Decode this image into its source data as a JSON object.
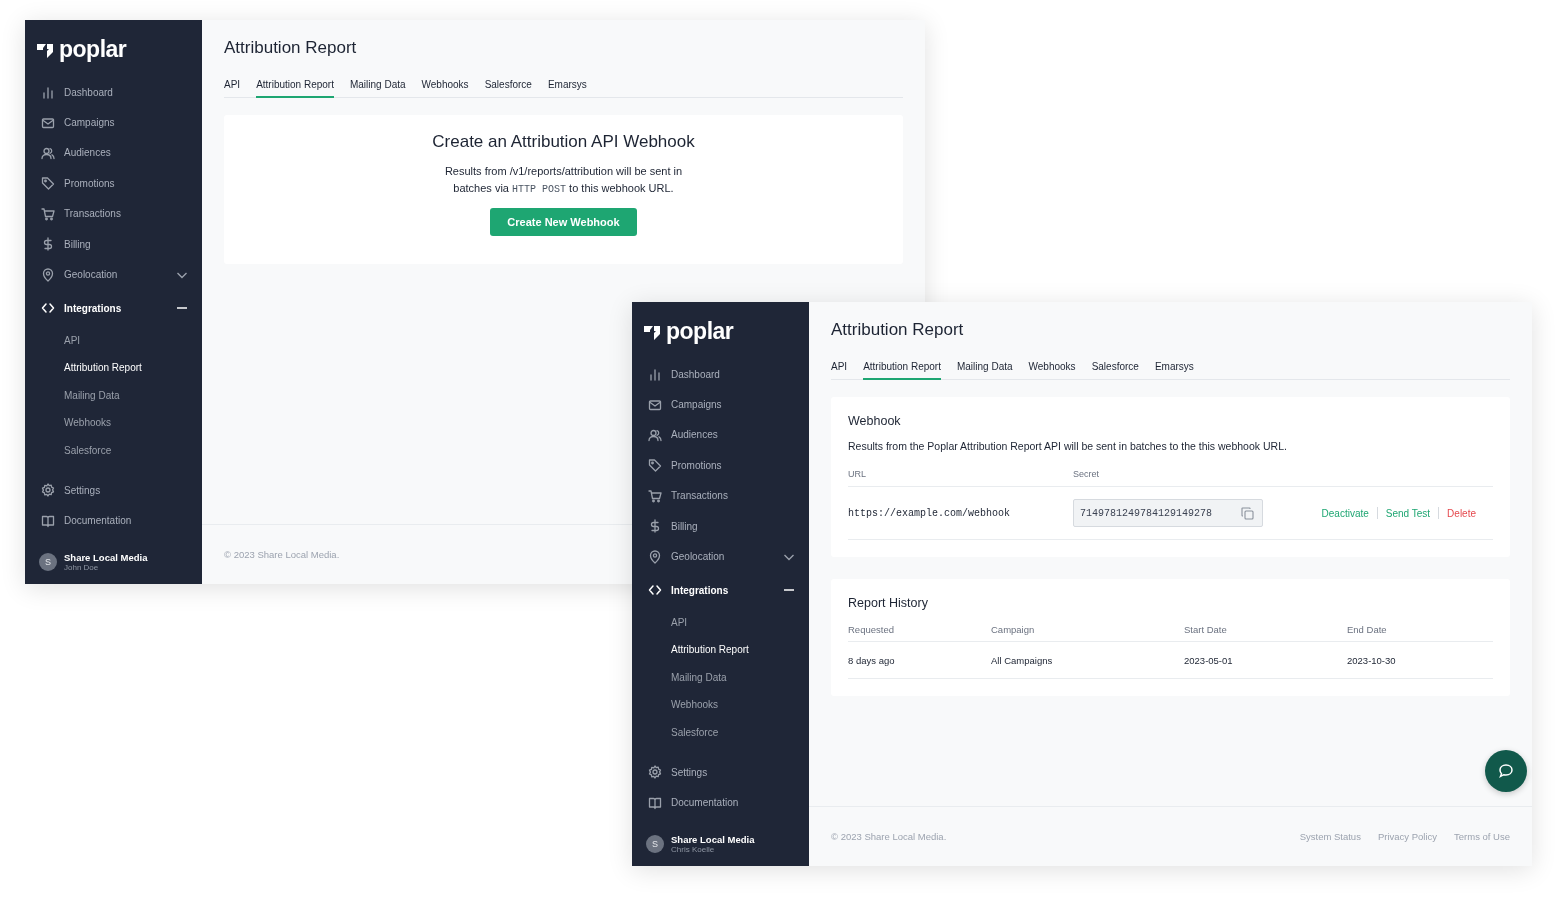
{
  "windows": [
    {
      "brand": "poplar",
      "nav": [
        {
          "label": "Dashboard",
          "selected": false
        },
        {
          "label": "Campaigns",
          "selected": false
        },
        {
          "label": "Audiences",
          "selected": false
        },
        {
          "label": "Promotions",
          "selected": false
        },
        {
          "label": "Transactions",
          "selected": false
        },
        {
          "label": "Billing",
          "selected": false
        },
        {
          "label": "Geolocation",
          "selected": false,
          "expanded": false
        },
        {
          "label": "Integrations",
          "selected": false,
          "expanded": true,
          "children": [
            {
              "label": "API",
              "selected": false
            },
            {
              "label": "Attribution Report",
              "selected": true
            },
            {
              "label": "Mailing Data",
              "selected": false
            },
            {
              "label": "Webhooks",
              "selected": false
            },
            {
              "label": "Salesforce",
              "selected": false
            }
          ]
        },
        {
          "label": "Settings",
          "selected": false
        },
        {
          "label": "Documentation",
          "selected": false
        }
      ],
      "user": {
        "initial": "S",
        "org": "Share Local Media",
        "name": "John Doe"
      },
      "title": "Attribution Report",
      "tabs": [
        {
          "label": "API",
          "selected": false
        },
        {
          "label": "Attribution Report",
          "selected": true
        },
        {
          "label": "Mailing Data",
          "selected": false
        },
        {
          "label": "Webhooks",
          "selected": false
        },
        {
          "label": "Salesforce",
          "selected": false
        },
        {
          "label": "Emarsys",
          "selected": false
        }
      ],
      "cards": [
        {
          "kind": "create",
          "heading": "Create an Attribution API Webhook",
          "text": "Results from /v1/reports/attribution will be sent in batches via ",
          "code": "HTTP POST",
          "text_after": " to this webhook URL.",
          "button": "Create New Webhook"
        }
      ],
      "footer": {
        "copyright": "© 2023 Share Local Media."
      }
    },
    {
      "brand": "poplar",
      "nav": [
        {
          "label": "Dashboard",
          "selected": false
        },
        {
          "label": "Campaigns",
          "selected": false
        },
        {
          "label": "Audiences",
          "selected": false
        },
        {
          "label": "Promotions",
          "selected": false
        },
        {
          "label": "Transactions",
          "selected": false
        },
        {
          "label": "Billing",
          "selected": false
        },
        {
          "label": "Geolocation",
          "selected": false,
          "expanded": false
        },
        {
          "label": "Integrations",
          "selected": false,
          "expanded": true,
          "children": [
            {
              "label": "API",
              "selected": false
            },
            {
              "label": "Attribution Report",
              "selected": true
            },
            {
              "label": "Mailing Data",
              "selected": false
            },
            {
              "label": "Webhooks",
              "selected": false
            },
            {
              "label": "Salesforce",
              "selected": false
            }
          ]
        },
        {
          "label": "Settings",
          "selected": false
        },
        {
          "label": "Documentation",
          "selected": false
        }
      ],
      "user": {
        "initial": "S",
        "org": "Share Local Media",
        "name": "Chris Koelle"
      },
      "title": "Attribution Report",
      "tabs": [
        {
          "label": "API",
          "selected": false
        },
        {
          "label": "Attribution Report",
          "selected": true
        },
        {
          "label": "Mailing Data",
          "selected": false
        },
        {
          "label": "Webhooks",
          "selected": false
        },
        {
          "label": "Salesforce",
          "selected": false
        },
        {
          "label": "Emarsys",
          "selected": false
        }
      ],
      "cards": [
        {
          "kind": "webhook",
          "heading": "Webhook",
          "text": "Results from the Poplar Attribution Report API will be sent in batches to the this webhook URL.",
          "columns": [
            "URL",
            "Secret"
          ],
          "url": "https://example.com/webhook",
          "secret": "7149781249784129149278",
          "actions": [
            {
              "label": "Deactivate",
              "kind": "normal"
            },
            {
              "label": "Send Test",
              "kind": "normal"
            },
            {
              "label": "Delete",
              "kind": "danger"
            }
          ]
        },
        {
          "kind": "history",
          "heading": "Report History",
          "columns": [
            "Requested",
            "Campaign",
            "Start Date",
            "End Date"
          ],
          "rows": [
            [
              "8 days ago",
              "All Campaigns",
              "2023-05-01",
              "2023-10-30"
            ]
          ]
        }
      ],
      "chat": true,
      "footer": {
        "copyright": "© 2023 Share Local Media.",
        "links": [
          "System Status",
          "Privacy Policy",
          "Terms of Use"
        ]
      }
    }
  ]
}
